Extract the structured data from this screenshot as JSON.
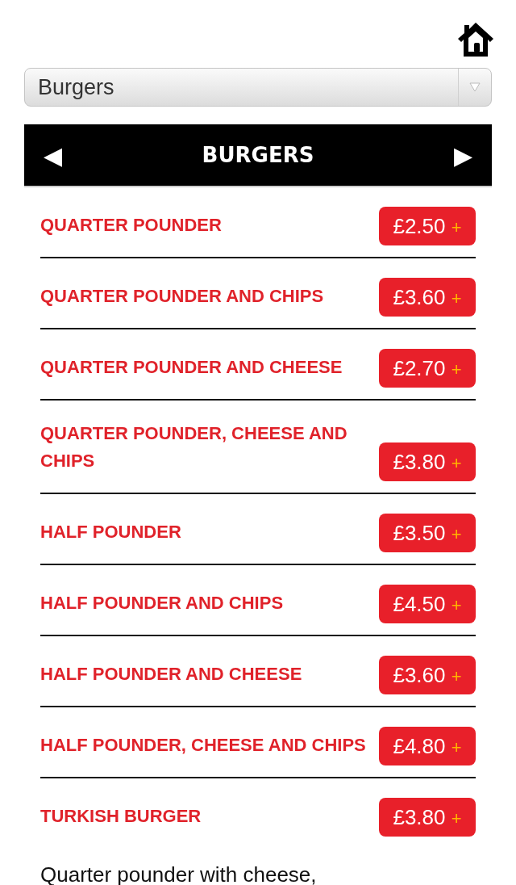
{
  "category_select": {
    "value": "Burgers"
  },
  "header": {
    "prev": "◀",
    "title": "BURGERS",
    "next": "▶"
  },
  "items": [
    {
      "name": "QUARTER POUNDER",
      "price": "£2.50",
      "add": "+"
    },
    {
      "name": "QUARTER POUNDER AND CHIPS",
      "price": "£3.60",
      "add": "+"
    },
    {
      "name": "QUARTER POUNDER AND CHEESE",
      "price": "£2.70",
      "add": "+"
    },
    {
      "name": "QUARTER POUNDER, CHEESE AND CHIPS",
      "price": "£3.80",
      "add": "+"
    },
    {
      "name": "HALF POUNDER",
      "price": "£3.50",
      "add": "+"
    },
    {
      "name": "HALF POUNDER AND CHIPS",
      "price": "£4.50",
      "add": "+"
    },
    {
      "name": "HALF POUNDER AND CHEESE",
      "price": "£3.60",
      "add": "+"
    },
    {
      "name": "HALF POUNDER, CHEESE AND CHIPS",
      "price": "£4.80",
      "add": "+"
    },
    {
      "name": "TURKISH BURGER",
      "price": "£3.80",
      "add": "+",
      "description": "Quarter pounder with cheese,"
    }
  ]
}
